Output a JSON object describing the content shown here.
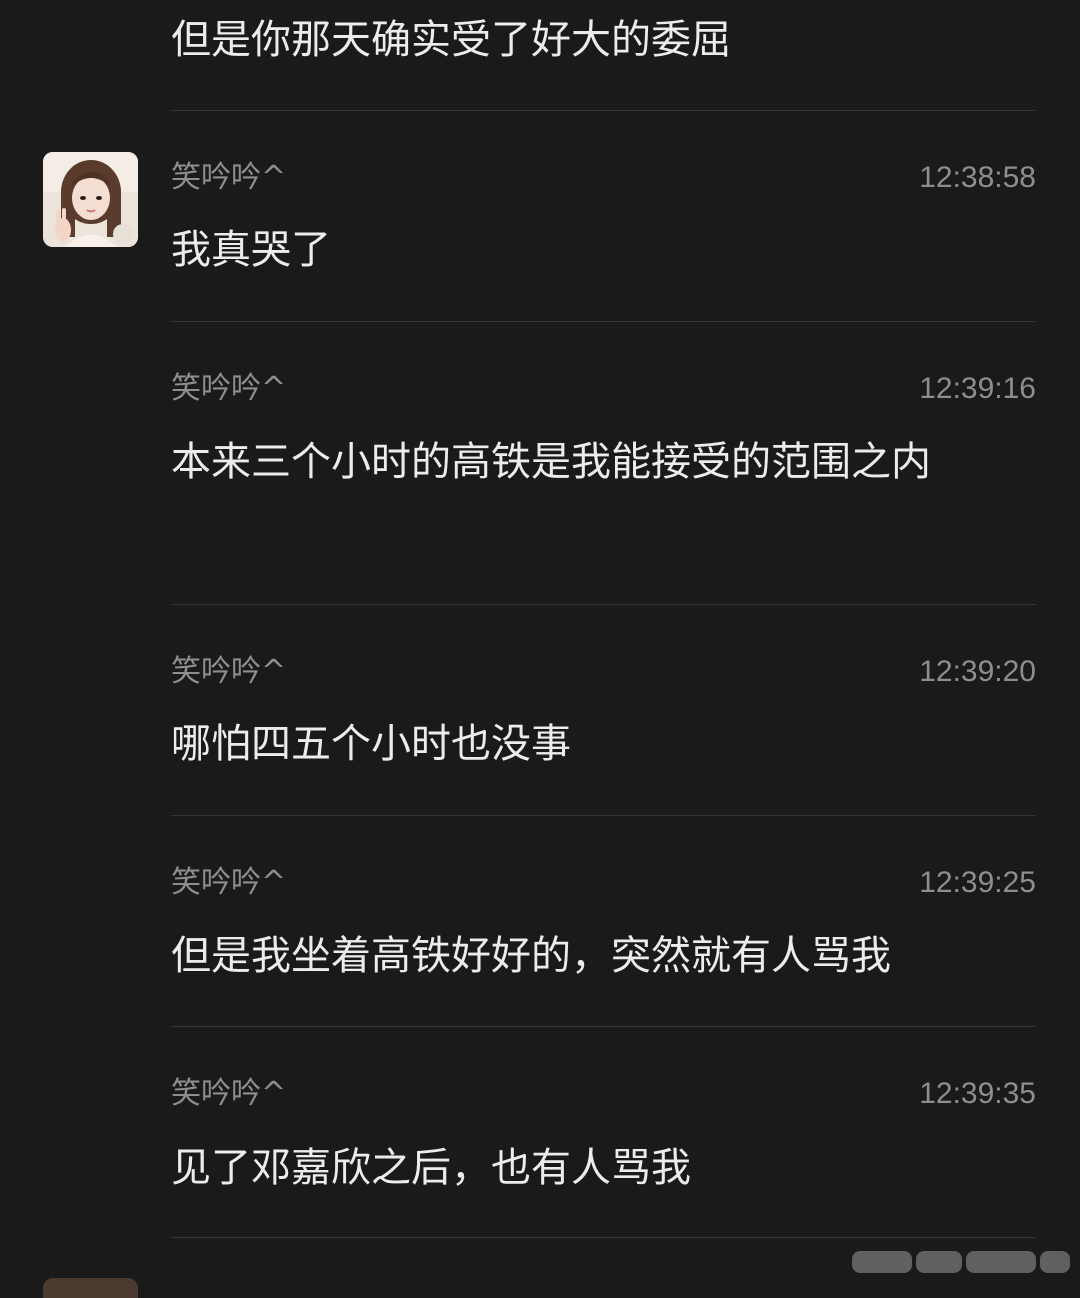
{
  "first_message": {
    "text": "但是你那天确实受了好大的委屈"
  },
  "messages": [
    {
      "sender": "笑吟吟^",
      "time": "12:38:58",
      "text": "我真哭了"
    },
    {
      "sender": "笑吟吟^",
      "time": "12:39:16",
      "text": "本来三个小时的高铁是我能接受的范围之内"
    },
    {
      "sender": "笑吟吟^",
      "time": "12:39:20",
      "text": "哪怕四五个小时也没事"
    },
    {
      "sender": "笑吟吟^",
      "time": "12:39:25",
      "text": "但是我坐着高铁好好的，突然就有人骂我"
    },
    {
      "sender": "笑吟吟^",
      "time": "12:39:35",
      "text": "见了邓嘉欣之后，也有人骂我"
    }
  ],
  "icons": {
    "avatar": "user-avatar-photo",
    "watermark": "platform-watermark"
  }
}
